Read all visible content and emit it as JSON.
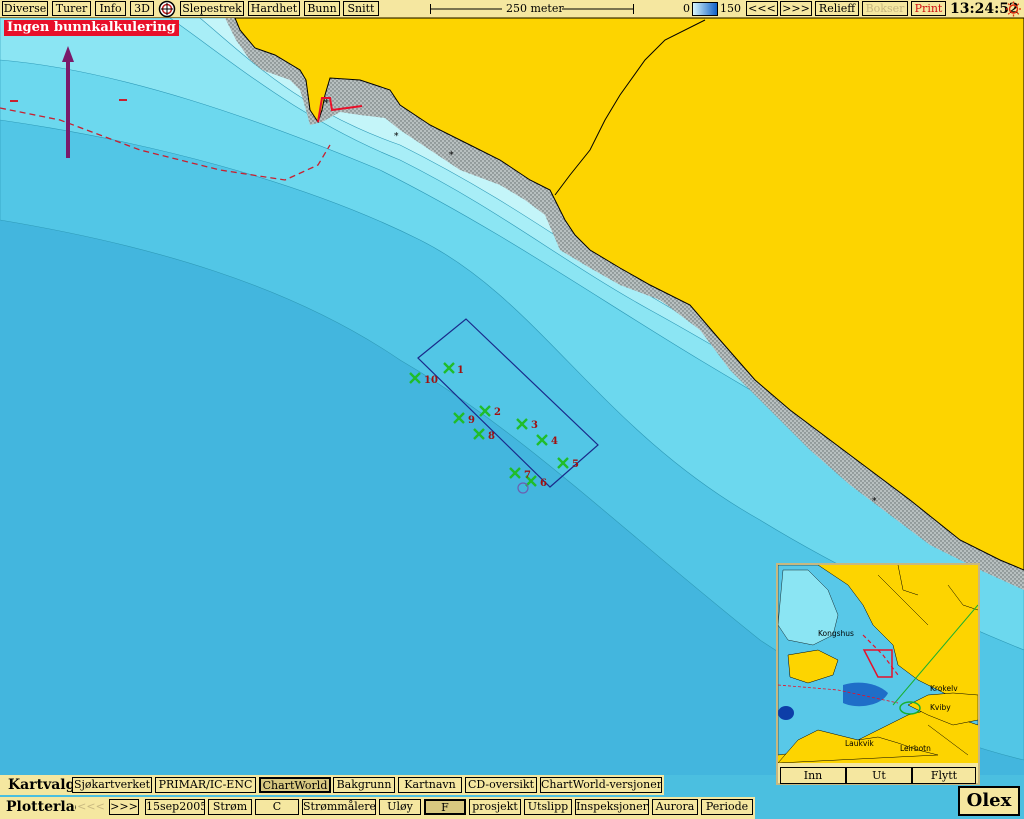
{
  "toolbar": {
    "diverse": "Diverse",
    "turer": "Turer",
    "info": "Info",
    "three_d": "3D",
    "slepestrek": "Slepestrek",
    "hardhet": "Hardhet",
    "bunn": "Bunn",
    "snitt": "Snitt",
    "scale_label": "250 meter",
    "depth_min": "0",
    "depth_max": "150",
    "prev": "<<<",
    "next": ">>>",
    "relieff": "Relieff",
    "bokser": "Bokser",
    "print": "Print",
    "clock": "13:24:52"
  },
  "warning": "Ingen bunnkalkulering",
  "markers": [
    {
      "label": "1"
    },
    {
      "label": "2"
    },
    {
      "label": "3"
    },
    {
      "label": "4"
    },
    {
      "label": "5"
    },
    {
      "label": "6"
    },
    {
      "label": "7"
    },
    {
      "label": "8"
    },
    {
      "label": "9"
    },
    {
      "label": "10"
    }
  ],
  "minimap": {
    "places": [
      "Kongshus",
      "Krokelv",
      "Kviby",
      "Laukvik",
      "Leirbotn"
    ],
    "zoom_in": "Inn",
    "zoom_out": "Ut",
    "move": "Flytt"
  },
  "kartvalg": {
    "label": "Kartvalg",
    "items": [
      "Sjøkartverket",
      "PRIMAR/IC-ENC",
      "ChartWorld",
      "Bakgrunn",
      "Kartnavn",
      "CD-oversikt",
      "ChartWorld-versjoner"
    ],
    "active": "ChartWorld"
  },
  "plotterlag": {
    "label": "Plotterlag",
    "prev": "<<<",
    "next": ">>>",
    "items": [
      "15sep2005",
      "Strøm",
      "C",
      "Strømmålere",
      "Uløy",
      "F",
      "prosjekt",
      "Utslipp",
      "Inspeksjoner",
      "Aurora",
      "Periode"
    ]
  },
  "brand": "Olex",
  "colors": {
    "land": "#fdd400",
    "deep_water": "#43b6de",
    "shallow_water": "#bff3f7",
    "marker": "#1fbd2a",
    "marker_label": "#a01010",
    "warning_bg": "#e8102a",
    "toolbar_bg": "#f5e7a0"
  }
}
